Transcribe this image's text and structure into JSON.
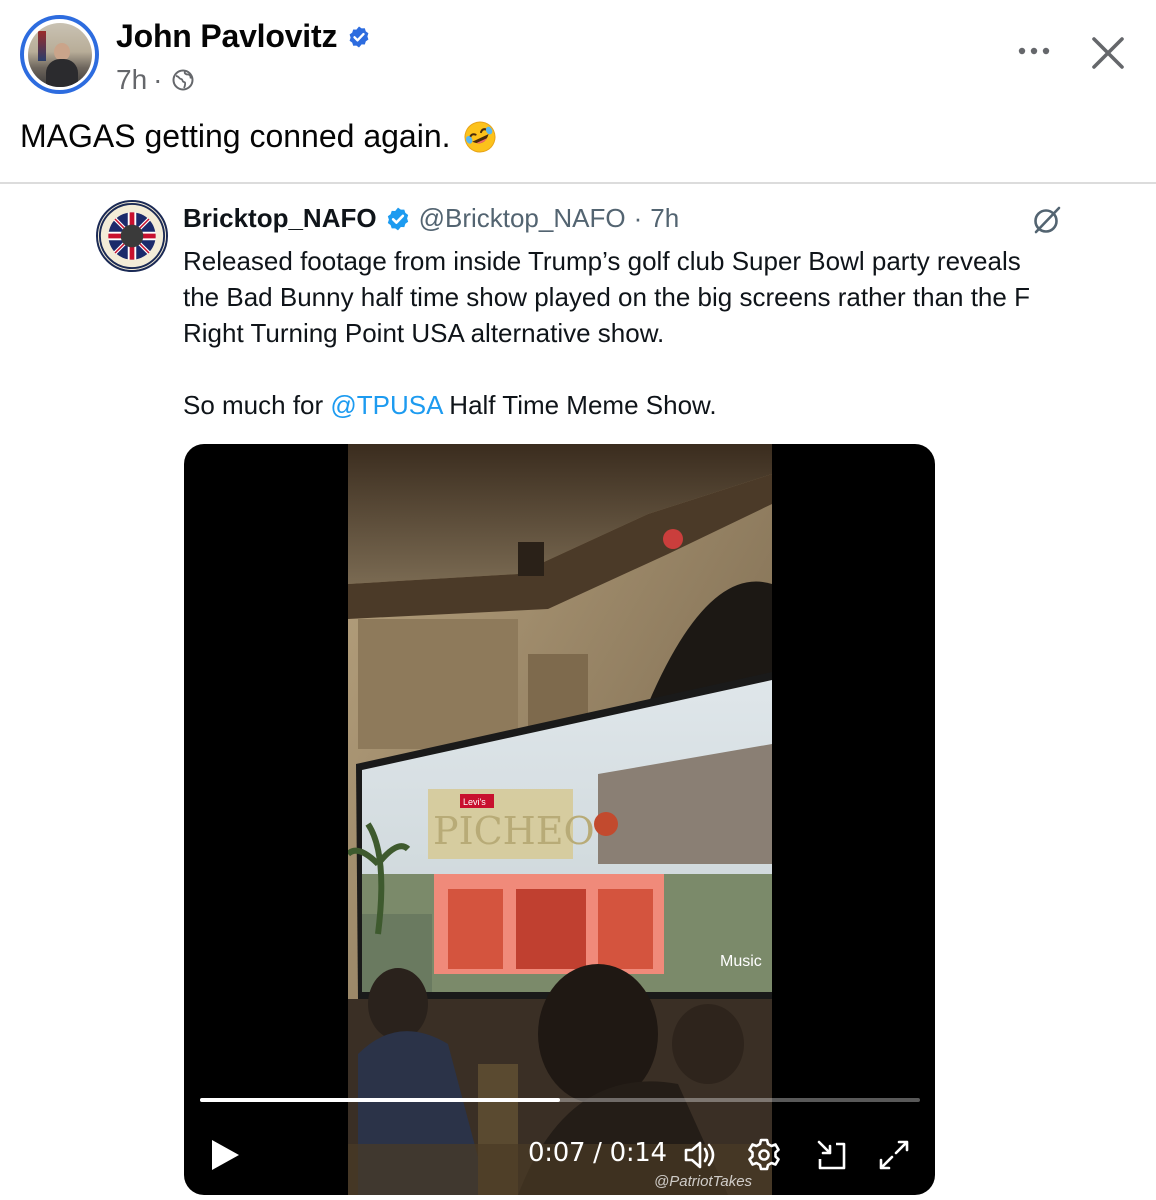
{
  "post": {
    "author_name": "John Pavlovitz",
    "timestamp": "7h",
    "separator": "·",
    "text": "MAGAS getting conned again.",
    "emoji": "rolling-on-the-floor-laughing"
  },
  "icons": {
    "verified": "verified-badge-icon",
    "audience": "globe-icon",
    "more": "more-options-icon",
    "close": "close-icon",
    "grok": "grok-icon"
  },
  "tweet": {
    "display_name": "Bricktop_NAFO",
    "handle": "@Bricktop_NAFO",
    "separator": "·",
    "timestamp": "7h",
    "lines": [
      "Released footage from inside Trump’s golf club Super Bowl party reveals",
      "the Bad Bunny half time show played on the big screens rather than the F",
      "Right Turning Point USA alternative show."
    ],
    "line4_prefix": "So much for ",
    "mention": "@TPUSA",
    "line4_suffix": " Half Time Meme Show."
  },
  "video": {
    "current_time": "0:07",
    "duration": "0:14",
    "time_separator": " / ",
    "progress": 0.5,
    "watermark": "@PatriotTakes",
    "screen_sign": "PICHEO",
    "screen_brand": "Levi's",
    "screen_logo": "Music"
  },
  "colors": {
    "fb_blue": "#2d6cdf",
    "link_blue": "#1d9bf0",
    "secondary_text": "#65676b",
    "tweet_secondary": "#536471"
  }
}
